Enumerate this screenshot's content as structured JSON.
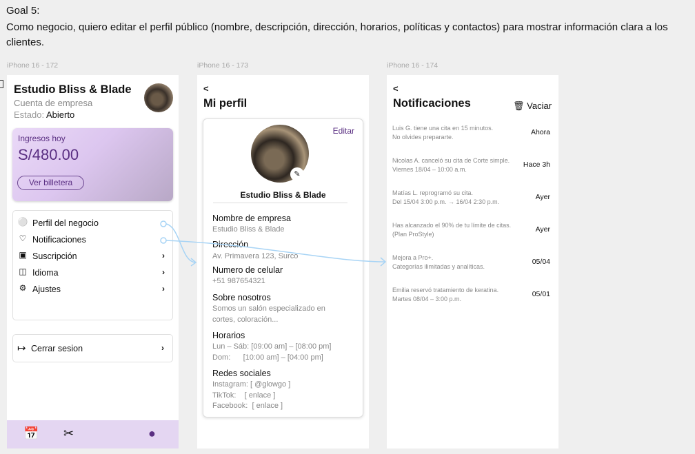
{
  "goal": {
    "title": "Goal 5:",
    "text": "Como negocio, quiero editar el perfil público (nombre, descripción, dirección, horarios, políticas y contactos) para mostrar información clara a los clientes."
  },
  "frames": [
    {
      "label": "iPhone 16 - 172"
    },
    {
      "label": "iPhone 16 - 173"
    },
    {
      "label": "iPhone 16 - 174"
    }
  ],
  "home": {
    "business_name": "Estudio Bliss & Blade",
    "account_type": "Cuenta de empresa",
    "state_label": "Estado:",
    "state_value": "Abierto",
    "income_label": "Ingresos hoy",
    "income_value": "S/480.00",
    "wallet_button": "Ver billetera",
    "menu": [
      {
        "label": "Perfil del negocio",
        "icon": "user-icon"
      },
      {
        "label": "Notificaciones",
        "icon": "bell-icon"
      },
      {
        "label": "Suscripción",
        "icon": "wallet-icon"
      },
      {
        "label": "Idioma",
        "icon": "translate-icon"
      },
      {
        "label": "Ajustes",
        "icon": "gear-icon"
      }
    ],
    "logout": "Cerrar sesion",
    "nav_icons": [
      "calendar-icon",
      "scissors-icon",
      "profile-icon"
    ]
  },
  "profile": {
    "title": "Mi perfil",
    "edit": "Editar",
    "card_name": "Estudio Bliss & Blade",
    "fields": [
      {
        "label": "Nombre de empresa",
        "value": "Estudio Bliss & Blade"
      },
      {
        "label": "Dirección",
        "value": "Av. Primavera 123, Surco"
      },
      {
        "label": "Numero de celular",
        "value": "+51 987654321"
      },
      {
        "label": "Sobre nosotros",
        "value": "Somos un salón especializado en\ncortes, coloración..."
      },
      {
        "label": "Horarios",
        "value": "Lun – Sáb: [09:00 am] – [08:00 pm]\nDom:      [10:00 am] – [04:00 pm]"
      },
      {
        "label": "Redes sociales",
        "value": "Instagram: [ @glowgo ]\nTikTok:    [ enlace ]\nFacebook:  [ enlace ]"
      }
    ]
  },
  "notifications": {
    "title": "Notificaciones",
    "clear": "Vaciar",
    "items": [
      {
        "text": "Luis G. tiene una cita en 15 minutos.\nNo olvides prepararte.",
        "when": "Ahora"
      },
      {
        "text": "Nicolas A. canceló su cita de Corte simple.\nViernes 18/04 – 10:00 a.m.",
        "when": "Hace 3h"
      },
      {
        "text": "Matías L. reprogramó su cita.\nDel 15/04 3:00 p.m. → 16/04 2:30 p.m.",
        "when": "Ayer"
      },
      {
        "text": "Has alcanzado el 90% de tu límite de citas.\n(Plan ProStyle)",
        "when": "Ayer"
      },
      {
        "text": "Mejora a Pro+.\nCategorías ilimitadas y analíticas.",
        "when": "05/04"
      },
      {
        "text": "Emilia reservó tratamiento de keratina.\nMartes 08/04 – 3:00 p.m.",
        "when": "05/01"
      }
    ]
  },
  "colors": {
    "accent": "#5a2f82",
    "connector": "#a8d4f5"
  }
}
